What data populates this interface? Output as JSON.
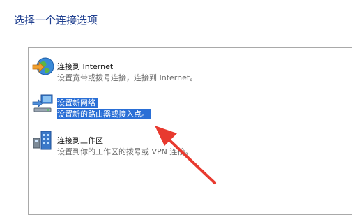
{
  "page": {
    "title": "选择一个连接选项"
  },
  "options": [
    {
      "title": "连接到 Internet",
      "desc": "设置宽带或拨号连接，连接到 Internet。",
      "icon": "globe-internet-icon",
      "selected": false
    },
    {
      "title": "设置新网络",
      "desc": "设置新的路由器或接入点。",
      "icon": "router-network-icon",
      "selected": true
    },
    {
      "title": "连接到工作区",
      "desc": "设置到你的工作区的拨号或 VPN 连接。",
      "icon": "workplace-connection-icon",
      "selected": false
    }
  ],
  "colors": {
    "selection": "#2a6fd6",
    "annotation_arrow": "#e83a2f",
    "title": "#1f3f8f"
  }
}
